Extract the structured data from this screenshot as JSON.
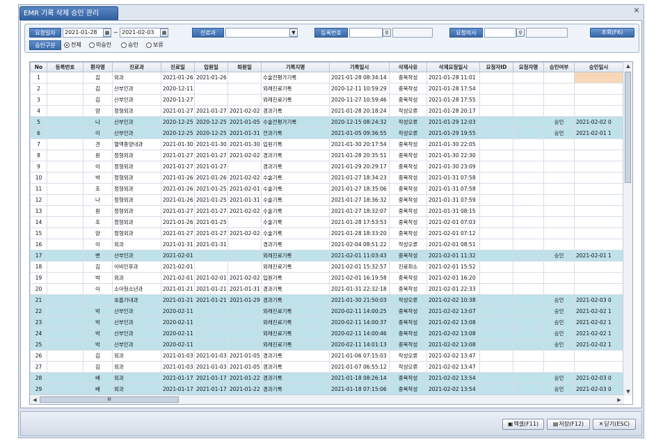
{
  "window": {
    "title": "EMR 기록 삭제 승인 관리",
    "close": "×"
  },
  "filters": {
    "request_date_label": "요청일자",
    "date_from": "2021-01-28",
    "date_sep": "~",
    "date_to": "2021-02-03",
    "department_label": "진료과",
    "department_value": "",
    "reg_no_label": "등록번호",
    "reg_no_value": "",
    "doctor_label": "요청의사",
    "doctor_value": "",
    "search_button": "조회(F6)",
    "approval_type_label": "승인구분",
    "radios": [
      {
        "label": "전체",
        "checked": true
      },
      {
        "label": "미승인",
        "checked": false
      },
      {
        "label": "승인",
        "checked": false
      },
      {
        "label": "보류",
        "checked": false
      }
    ]
  },
  "grid": {
    "columns": [
      "No",
      "등록번호",
      "환자명",
      "진료과",
      "진료일",
      "입원일",
      "퇴원일",
      "기록지명",
      "기록일시",
      "삭제사유",
      "삭제요청일시",
      "요청자ID",
      "요청자명",
      "승인여부",
      "승인일시"
    ],
    "rows": [
      {
        "no": "1",
        "reg": "",
        "name": "김",
        "dept": "외과",
        "visit": "2021-01-26",
        "adm": "2021-01-26",
        "dis": "",
        "doc": "수술전평가기록",
        "recdt": "2021-01-28 08:34:14",
        "reason": "중복작성",
        "reqdt": "2021-01-28 11:01",
        "reqid": "",
        "reqname": "",
        "appr": "",
        "apprdt": "",
        "approved": false
      },
      {
        "no": "2",
        "reg": "",
        "name": "김",
        "dept": "산부인과",
        "visit": "2020-12-11",
        "adm": "",
        "dis": "",
        "doc": "외래진료기록",
        "recdt": "2020-12-11 10:59:29",
        "reason": "중복작성",
        "reqdt": "2021-01-28 17:54",
        "reqid": "",
        "reqname": "",
        "appr": "",
        "apprdt": "",
        "approved": false
      },
      {
        "no": "3",
        "reg": "",
        "name": "김",
        "dept": "산부인과",
        "visit": "2020-11-27",
        "adm": "",
        "dis": "",
        "doc": "외래진료기록",
        "recdt": "2020-11-27 10:59:46",
        "reason": "중복작성",
        "reqdt": "2021-01-28 17:55",
        "reqid": "",
        "reqname": "",
        "appr": "",
        "apprdt": "",
        "approved": false
      },
      {
        "no": "4",
        "reg": "",
        "name": "양",
        "dept": "정형외과",
        "visit": "2021-01-27",
        "adm": "2021-01-27",
        "dis": "2021-02-02",
        "doc": "경과기록",
        "recdt": "2021-01-28 20:18:24",
        "reason": "작성오류",
        "reqdt": "2021-01-28 20:17",
        "reqid": "",
        "reqname": "",
        "appr": "",
        "apprdt": "",
        "approved": false
      },
      {
        "no": "5",
        "reg": "",
        "name": "나",
        "dept": "산부인과",
        "visit": "2020-12-25",
        "adm": "2020-12-25",
        "dis": "2021-01-05",
        "doc": "수술전평가기록",
        "recdt": "2020-12-15 08:24:32",
        "reason": "작성오류",
        "reqdt": "2021-01-29 12:03",
        "reqid": "",
        "reqname": "",
        "appr": "승인",
        "apprdt": "2021-02-02 0",
        "approved": true
      },
      {
        "no": "6",
        "reg": "",
        "name": "이",
        "dept": "산부인과",
        "visit": "2020-12-25",
        "adm": "2020-12-25",
        "dis": "2021-01-31",
        "doc": "전과기록",
        "recdt": "2021-01-05 09:36:55",
        "reason": "작성오류",
        "reqdt": "2021-01-29 19:55",
        "reqid": "",
        "reqname": "",
        "appr": "승인",
        "apprdt": "2021-02-01 1",
        "approved": true
      },
      {
        "no": "7",
        "reg": "",
        "name": "견",
        "dept": "혈액종양내과",
        "visit": "2021-01-30",
        "adm": "2021-01-30",
        "dis": "2021-01-30",
        "doc": "입원기록",
        "recdt": "2021-01-30 20:17:54",
        "reason": "중복작성",
        "reqdt": "2021-01-30 22:05",
        "reqid": "",
        "reqname": "",
        "appr": "",
        "apprdt": "",
        "approved": false
      },
      {
        "no": "8",
        "reg": "",
        "name": "원",
        "dept": "정형외과",
        "visit": "2021-01-27",
        "adm": "2021-01-27",
        "dis": "2021-02-02",
        "doc": "경과기록",
        "recdt": "2021-01-28 20:35:51",
        "reason": "중복작성",
        "reqdt": "2021-01-30 22:30",
        "reqid": "",
        "reqname": "",
        "appr": "",
        "apprdt": "",
        "approved": false
      },
      {
        "no": "9",
        "reg": "",
        "name": "이",
        "dept": "정형외과",
        "visit": "2021-01-27",
        "adm": "2021-01-27",
        "dis": "",
        "doc": "경과기록",
        "recdt": "2021-01-29 20:29:17",
        "reason": "중복작성",
        "reqdt": "2021-01-30 23:09",
        "reqid": "",
        "reqname": "",
        "appr": "",
        "apprdt": "",
        "approved": false
      },
      {
        "no": "10",
        "reg": "",
        "name": "박",
        "dept": "정형외과",
        "visit": "2021-01-26",
        "adm": "2021-01-26",
        "dis": "2021-02-02",
        "doc": "수술기록",
        "recdt": "2021-01-27 18:34:23",
        "reason": "중복작성",
        "reqdt": "2021-01-31 07:58",
        "reqid": "",
        "reqname": "",
        "appr": "",
        "apprdt": "",
        "approved": false
      },
      {
        "no": "11",
        "reg": "",
        "name": "조",
        "dept": "정형외과",
        "visit": "2021-01-26",
        "adm": "2021-01-25",
        "dis": "2021-02-01",
        "doc": "수술기록",
        "recdt": "2021-01-27 18:35:06",
        "reason": "중복작성",
        "reqdt": "2021-01-31 07:58",
        "reqid": "",
        "reqname": "",
        "appr": "",
        "apprdt": "",
        "approved": false
      },
      {
        "no": "12",
        "reg": "",
        "name": "나",
        "dept": "정형외과",
        "visit": "2021-01-26",
        "adm": "2021-01-25",
        "dis": "2021-01-31",
        "doc": "수술기록",
        "recdt": "2021-01-27 18:36:32",
        "reason": "중복작성",
        "reqdt": "2021-01-31 07:59",
        "reqid": "",
        "reqname": "",
        "appr": "",
        "apprdt": "",
        "approved": false
      },
      {
        "no": "13",
        "reg": "",
        "name": "원",
        "dept": "정형외과",
        "visit": "2021-01-27",
        "adm": "2021-01-27",
        "dis": "2021-02-02",
        "doc": "수술기록",
        "recdt": "2021-01-27 18:32:07",
        "reason": "중복작성",
        "reqdt": "2021-01-31 08:15",
        "reqid": "",
        "reqname": "",
        "appr": "",
        "apprdt": "",
        "approved": false
      },
      {
        "no": "14",
        "reg": "",
        "name": "조",
        "dept": "정형외과",
        "visit": "2021-01-26",
        "adm": "2021-01-25",
        "dis": "",
        "doc": "수술기록",
        "recdt": "2021-01-28 17:53:53",
        "reason": "중복작성",
        "reqdt": "2021-02-01 07:03",
        "reqid": "",
        "reqname": "",
        "appr": "",
        "apprdt": "",
        "approved": false
      },
      {
        "no": "15",
        "reg": "",
        "name": "양",
        "dept": "정형외과",
        "visit": "2021-01-27",
        "adm": "2021-01-27",
        "dis": "2021-02-02",
        "doc": "수술기록",
        "recdt": "2021-01-28 18:33:20",
        "reason": "중복작성",
        "reqdt": "2021-02-01 07:12",
        "reqid": "",
        "reqname": "",
        "appr": "",
        "apprdt": "",
        "approved": false
      },
      {
        "no": "16",
        "reg": "",
        "name": "이",
        "dept": "외과",
        "visit": "2021-01-31",
        "adm": "2021-01-31",
        "dis": "",
        "doc": "경과기록",
        "recdt": "2021-02-04 08:51:22",
        "reason": "작성오류",
        "reqdt": "2021-02-01 08:51",
        "reqid": "",
        "reqname": "",
        "appr": "",
        "apprdt": "",
        "approved": false
      },
      {
        "no": "17",
        "reg": "",
        "name": "변",
        "dept": "산부인과",
        "visit": "2021-02-01",
        "adm": "",
        "dis": "",
        "doc": "외래진료기록",
        "recdt": "2021-02-01 11:03:43",
        "reason": "중복작성",
        "reqdt": "2021-02-01 11:32",
        "reqid": "",
        "reqname": "",
        "appr": "승인",
        "apprdt": "2021-02-01 1",
        "approved": true
      },
      {
        "no": "18",
        "reg": "",
        "name": "김",
        "dept": "이비인후과",
        "visit": "2021-02-01",
        "adm": "",
        "dis": "",
        "doc": "외래진료기록",
        "recdt": "2021-02-01 15:32:57",
        "reason": "진료취소",
        "reqdt": "2021-02-01 15:52",
        "reqid": "",
        "reqname": "",
        "appr": "",
        "apprdt": "",
        "approved": false
      },
      {
        "no": "19",
        "reg": "",
        "name": "박",
        "dept": "외과",
        "visit": "2021-02-01",
        "adm": "2021-02-01",
        "dis": "2021-02-02",
        "doc": "입원기록",
        "recdt": "2021-02-01 16:19:58",
        "reason": "중복작성",
        "reqdt": "2021-02-01 16:20",
        "reqid": "",
        "reqname": "",
        "appr": "",
        "apprdt": "",
        "approved": false
      },
      {
        "no": "20",
        "reg": "",
        "name": "이",
        "dept": "소아청소년과",
        "visit": "2021-01-21",
        "adm": "2021-01-21",
        "dis": "2021-01-31",
        "doc": "경과기록",
        "recdt": "2021-01-31 22:32:18",
        "reason": "중복작성",
        "reqdt": "2021-02-01 22:33",
        "reqid": "",
        "reqname": "",
        "appr": "",
        "apprdt": "",
        "approved": false
      },
      {
        "no": "21",
        "reg": "",
        "name": "",
        "dept": "호흡기내과",
        "visit": "2021-01-21",
        "adm": "2021-01-21",
        "dis": "2021-01-29",
        "doc": "경과기록",
        "recdt": "2021-01-30 21:50:03",
        "reason": "작성오류",
        "reqdt": "2021-02-02 10:38",
        "reqid": "",
        "reqname": "",
        "appr": "승인",
        "apprdt": "2021-02-03 0",
        "approved": true
      },
      {
        "no": "22",
        "reg": "",
        "name": "박",
        "dept": "산부인과",
        "visit": "2020-02-11",
        "adm": "",
        "dis": "",
        "doc": "외래진료기록",
        "recdt": "2020-02-11 14:00:25",
        "reason": "중복작성",
        "reqdt": "2021-02-02 13:07",
        "reqid": "",
        "reqname": "",
        "appr": "승인",
        "apprdt": "2021-02-02 1",
        "approved": true
      },
      {
        "no": "23",
        "reg": "",
        "name": "박",
        "dept": "산부인과",
        "visit": "2020-02-11",
        "adm": "",
        "dis": "",
        "doc": "외래진료기록",
        "recdt": "2020-02-11 14:00:37",
        "reason": "중복작성",
        "reqdt": "2021-02-02 13:08",
        "reqid": "",
        "reqname": "",
        "appr": "승인",
        "apprdt": "2021-02-02 1",
        "approved": true
      },
      {
        "no": "24",
        "reg": "",
        "name": "박",
        "dept": "산부인과",
        "visit": "2020-02-11",
        "adm": "",
        "dis": "",
        "doc": "외래진료기록",
        "recdt": "2020-02-11 14:00:46",
        "reason": "중복작성",
        "reqdt": "2021-02-02 13:08",
        "reqid": "",
        "reqname": "",
        "appr": "승인",
        "apprdt": "2021-02-02 1",
        "approved": true
      },
      {
        "no": "25",
        "reg": "",
        "name": "박",
        "dept": "산부인과",
        "visit": "2020-02-11",
        "adm": "",
        "dis": "",
        "doc": "외래진료기록",
        "recdt": "2020-02-11 14:01:13",
        "reason": "중복작성",
        "reqdt": "2021-02-02 13:08",
        "reqid": "",
        "reqname": "",
        "appr": "승인",
        "apprdt": "2021-02-02 1",
        "approved": true
      },
      {
        "no": "26",
        "reg": "",
        "name": "김",
        "dept": "외과",
        "visit": "2021-01-03",
        "adm": "2021-01-03",
        "dis": "2021-01-05",
        "doc": "경과기록",
        "recdt": "2021-01-06 07:15:03",
        "reason": "작성오류",
        "reqdt": "2021-02-02 13:47",
        "reqid": "",
        "reqname": "",
        "appr": "",
        "apprdt": "",
        "approved": false
      },
      {
        "no": "27",
        "reg": "",
        "name": "김",
        "dept": "외과",
        "visit": "2021-01-03",
        "adm": "2021-01-03",
        "dis": "2021-01-05",
        "doc": "경과기록",
        "recdt": "2021-01-07 06:55:12",
        "reason": "작성오류",
        "reqdt": "2021-02-02 13:47",
        "reqid": "",
        "reqname": "",
        "appr": "",
        "apprdt": "",
        "approved": false
      },
      {
        "no": "28",
        "reg": "",
        "name": "배",
        "dept": "외과",
        "visit": "2021-01-17",
        "adm": "2021-01-17",
        "dis": "2021-01-22",
        "doc": "경과기록",
        "recdt": "2021-01-18 08:26:14",
        "reason": "중복작성",
        "reqdt": "2021-02-02 13:54",
        "reqid": "",
        "reqname": "",
        "appr": "승인",
        "apprdt": "2021-02-03 0",
        "approved": true
      },
      {
        "no": "29",
        "reg": "",
        "name": "배",
        "dept": "외과",
        "visit": "2021-01-17",
        "adm": "2021-01-17",
        "dis": "2021-01-22",
        "doc": "경과기록",
        "recdt": "2021-01-18 07:15:06",
        "reason": "중복작성",
        "reqdt": "2021-02-02 13:54",
        "reqid": "",
        "reqname": "",
        "appr": "승인",
        "apprdt": "2021-02-03 0",
        "approved": true
      }
    ]
  },
  "scroll": {
    "h_thumb": "III"
  },
  "footer": {
    "excel": "엑셀(F11)",
    "save": "저장(F12)",
    "close": "닫기(ESC)"
  },
  "icons": {
    "calendar": "calendar-icon",
    "search": "search-icon",
    "dropdown": "chevron-down-icon"
  },
  "colors": {
    "approved_row": "#bfe1ea",
    "label_bg": "#3a68a8",
    "selected_cell": "#f7d7b8"
  }
}
